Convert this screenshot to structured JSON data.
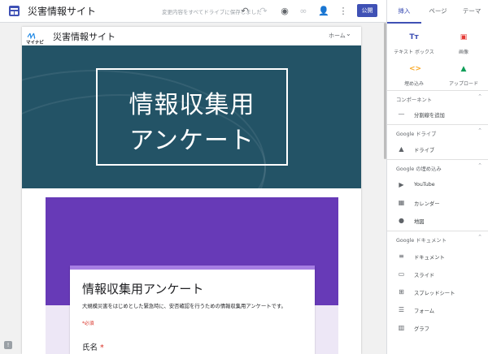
{
  "topbar": {
    "site_title": "災害情報サイト",
    "save_status": "変更内容をすべてドライブに保存しました",
    "publish_label": "公開"
  },
  "panel": {
    "tabs": [
      "挿入",
      "ページ",
      "テーマ"
    ],
    "insert_items": [
      {
        "icon": "text-box-icon",
        "glyph": "Tт",
        "label": "テキスト ボックス",
        "color": "#3f51b5"
      },
      {
        "icon": "image-icon",
        "glyph": "▣",
        "label": "画像",
        "color": "#e53935"
      },
      {
        "icon": "embed-icon",
        "glyph": "<>",
        "label": "埋め込み",
        "color": "#f9a825"
      },
      {
        "icon": "upload-icon",
        "glyph": "▲",
        "label": "アップロード",
        "color": "#0f9d58"
      }
    ],
    "sections": [
      {
        "title": "コンポーネント",
        "items": [
          {
            "icon": "divider-icon",
            "glyph": "—",
            "label": "分割線を追加"
          }
        ]
      },
      {
        "title": "Google ドライブ",
        "items": [
          {
            "icon": "drive-icon",
            "glyph": "▲",
            "label": "ドライブ"
          }
        ]
      },
      {
        "title": "Google の埋め込み",
        "items": [
          {
            "icon": "youtube-icon",
            "glyph": "▶",
            "label": "YouTube"
          },
          {
            "icon": "calendar-icon",
            "glyph": "▦",
            "label": "カレンダー"
          },
          {
            "icon": "map-pin-icon",
            "glyph": "●",
            "label": "地図"
          }
        ]
      },
      {
        "title": "Google ドキュメント",
        "items": [
          {
            "icon": "docs-icon",
            "glyph": "≡",
            "label": "ドキュメント"
          },
          {
            "icon": "slides-icon",
            "glyph": "▭",
            "label": "スライド"
          },
          {
            "icon": "sheets-icon",
            "glyph": "⊞",
            "label": "スプレッドシート"
          },
          {
            "icon": "forms-icon",
            "glyph": "☰",
            "label": "フォーム"
          },
          {
            "icon": "charts-icon",
            "glyph": "▥",
            "label": "グラフ"
          }
        ]
      }
    ]
  },
  "page": {
    "logo_text": "マイナビ",
    "site_name": "災害情報サイト",
    "nav_label": "ホーム",
    "hero_line1": "情報収集用",
    "hero_line2": "アンケート"
  },
  "form": {
    "title": "情報収集用アンケート",
    "description": "大規模災害をはじめとした緊急時に、安否確認を行うための情報収集用アンケートです。",
    "required_note": "*必須",
    "field_label": "氏名",
    "required_star": "*"
  },
  "colors": {
    "accent": "#3f51b5",
    "hero_bg": "#235366",
    "form_header": "#673ab7"
  }
}
